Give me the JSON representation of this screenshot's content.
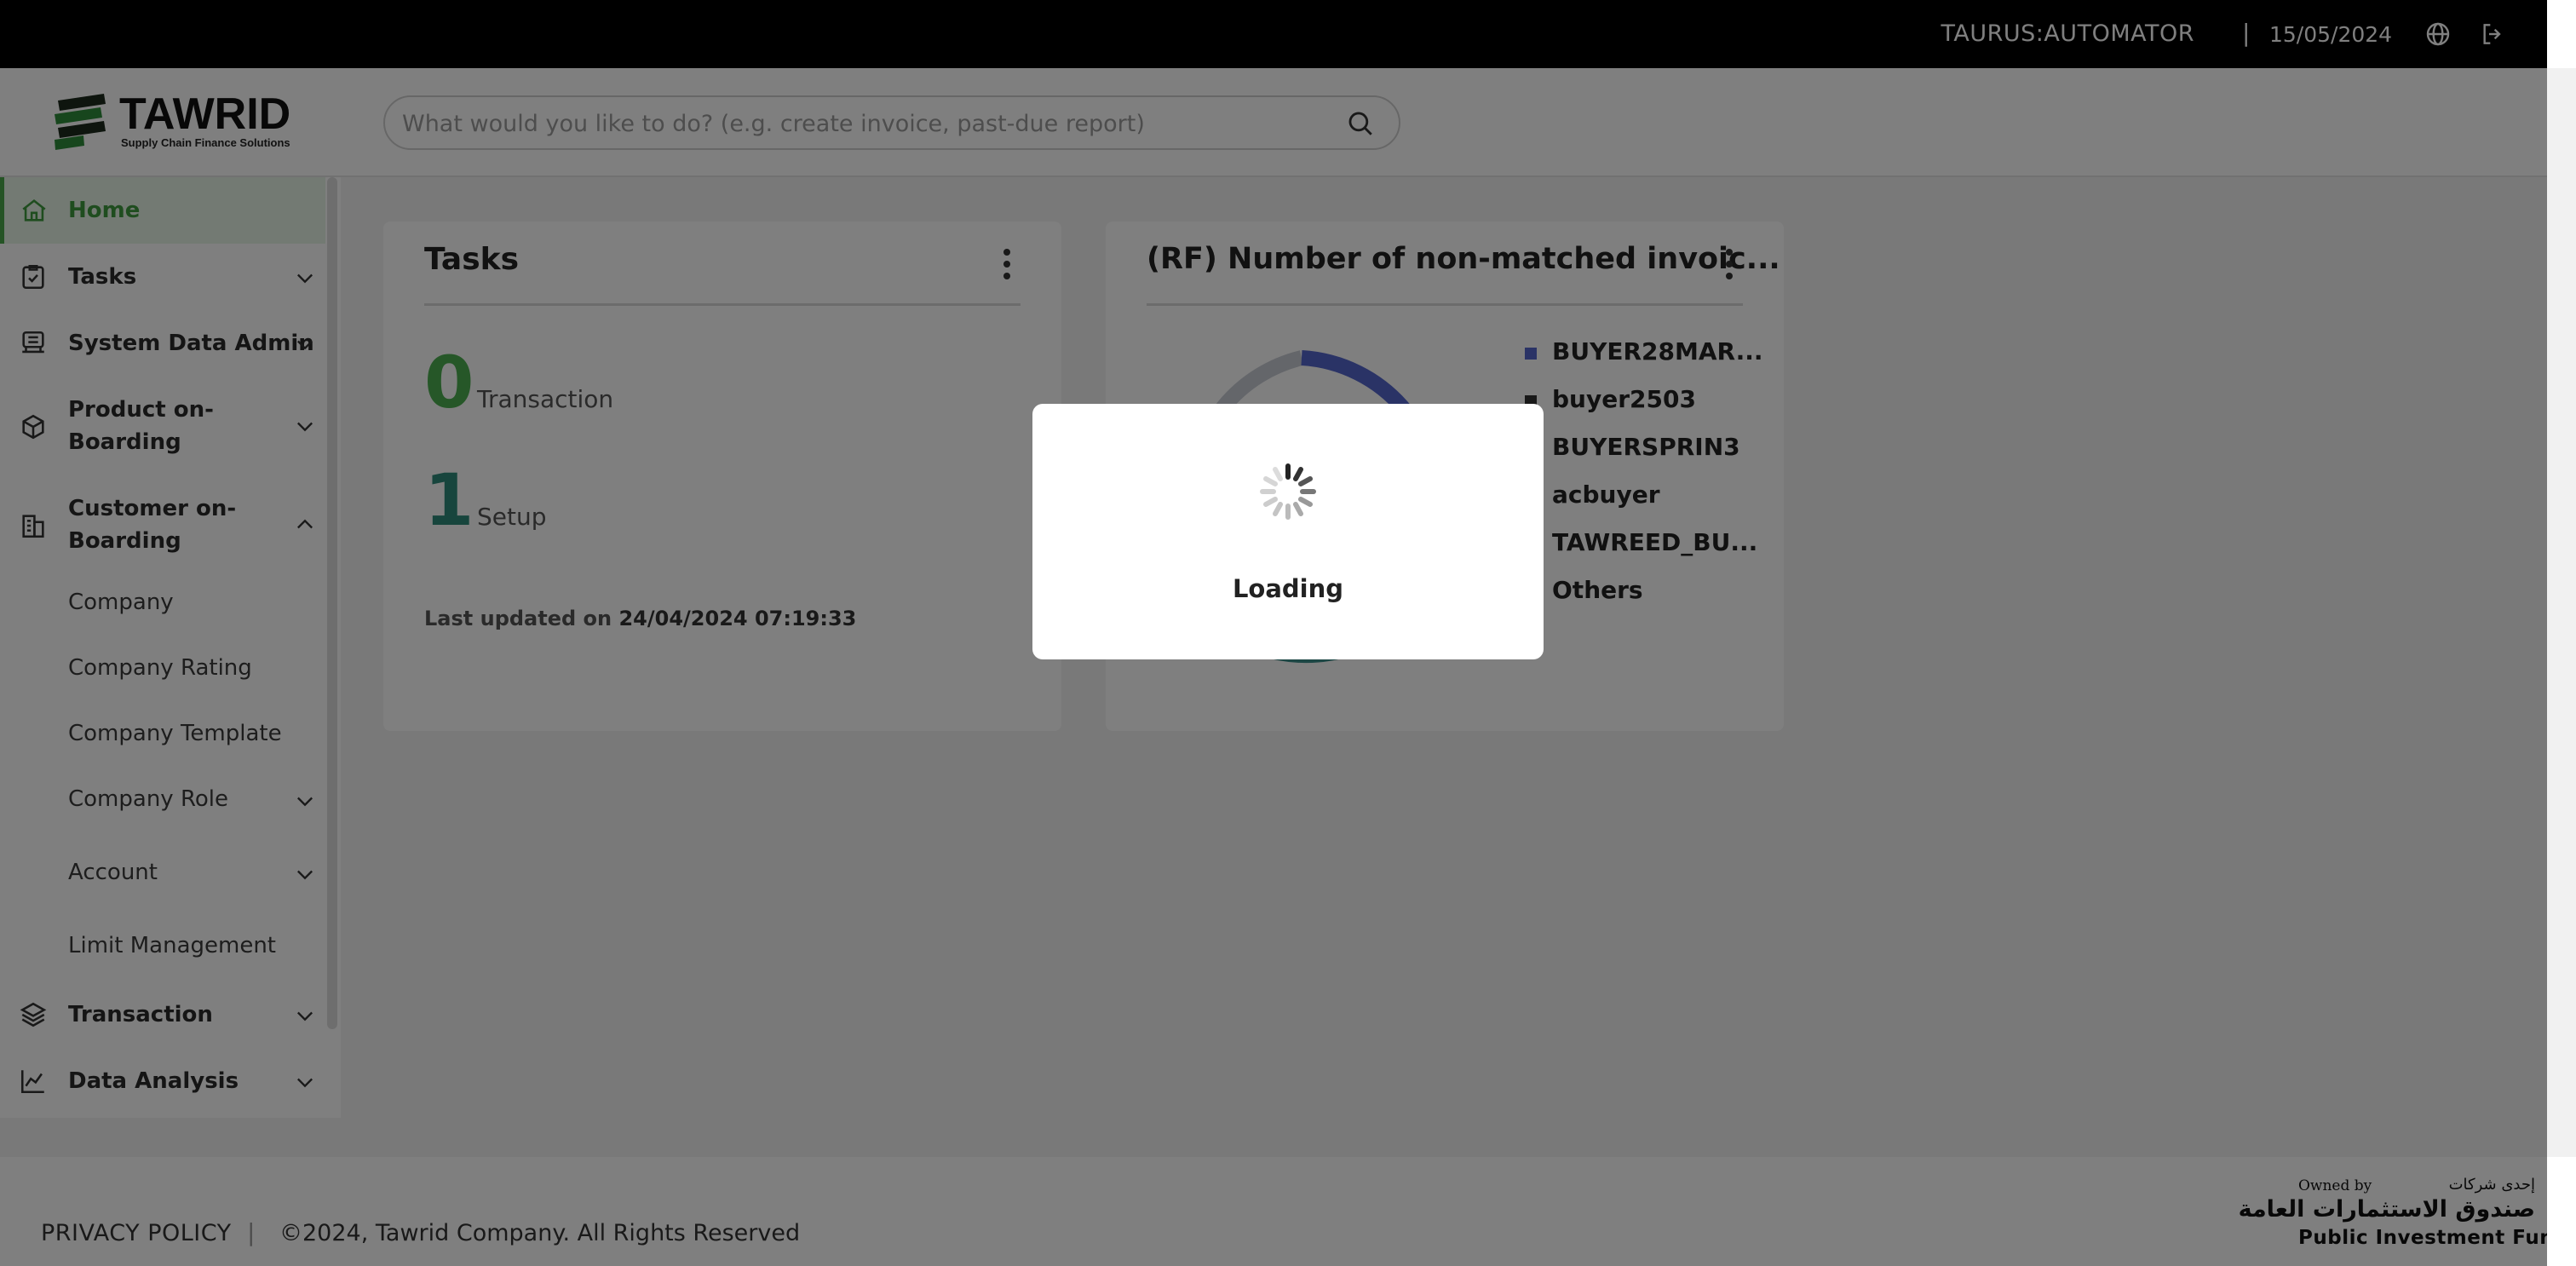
{
  "topbar": {
    "user": "TAURUS:AUTOMATOR",
    "separator": "|",
    "date": "15/05/2024",
    "icons": [
      "globe-icon",
      "logout-icon"
    ]
  },
  "header": {
    "logo_name": "TAWRID",
    "logo_tagline": "Supply Chain Finance Solutions",
    "search_placeholder": "What would you like to do? (e.g. create invoice, past-due report)"
  },
  "sidebar": {
    "items": [
      {
        "label": "Home",
        "icon": "home-icon",
        "active": true
      },
      {
        "label": "Tasks",
        "icon": "clipboard-check-icon"
      },
      {
        "label": "System Data Admin",
        "icon": "database-icon"
      },
      {
        "label": "Product on-\nBoarding",
        "line1": "Product on-",
        "line2": "Boarding",
        "icon": "package-icon"
      },
      {
        "label": "Customer on-\nBoarding",
        "line1": "Customer on-",
        "line2": "Boarding",
        "icon": "buildings-icon",
        "expanded": true
      },
      {
        "label": "Transaction",
        "icon": "layers-icon"
      },
      {
        "label": "Data Analysis",
        "icon": "chart-icon"
      }
    ],
    "sub_items": [
      {
        "label": "Company"
      },
      {
        "label": "Company Rating"
      },
      {
        "label": "Company Template"
      },
      {
        "label": "Company Role",
        "has_children": true
      },
      {
        "label": "Account",
        "has_children": true
      },
      {
        "label": "Limit Management"
      }
    ]
  },
  "tasks_card": {
    "title": "Tasks",
    "transaction_count": "0",
    "transaction_label": "Transaction",
    "setup_count": "1",
    "setup_label": "Setup",
    "updated_prefix": "Last updated on",
    "updated_value": "24/04/2024 07:19:33",
    "colors": {
      "transaction": "#4caf50",
      "setup": "#2e8b7a"
    }
  },
  "chart_card": {
    "title": "(RF) Number of non-matched invoic...",
    "legend": [
      "BUYER28MAR...",
      "buyer2503",
      "BUYERSPRIN3",
      "acbuyer",
      "TAWREED_BU...",
      "Others"
    ]
  },
  "chart_data": {
    "type": "pie",
    "title": "(RF) Number of non-matched invoic...",
    "categories": [
      "BUYER28MAR...",
      "buyer2503",
      "BUYERSPRIN3",
      "acbuyer",
      "TAWREED_BU...",
      "Others"
    ],
    "colors": [
      "#5566cc",
      "#333333",
      "#2b2b2b",
      "#2b2b2b",
      "#2b2b2b",
      "#2b2b2b"
    ]
  },
  "dialog": {
    "text": "Loading"
  },
  "footer": {
    "privacy": "PRIVACY POLICY",
    "separator": "|",
    "copyright": "©2024, Tawrid Company. All Rights Reserved",
    "owned_by": "Owned by",
    "arabic_small": "إحدى شركات",
    "arabic_large": "صندوق الاستثمارات العامة",
    "pif_name": "Public Investment Fund"
  }
}
